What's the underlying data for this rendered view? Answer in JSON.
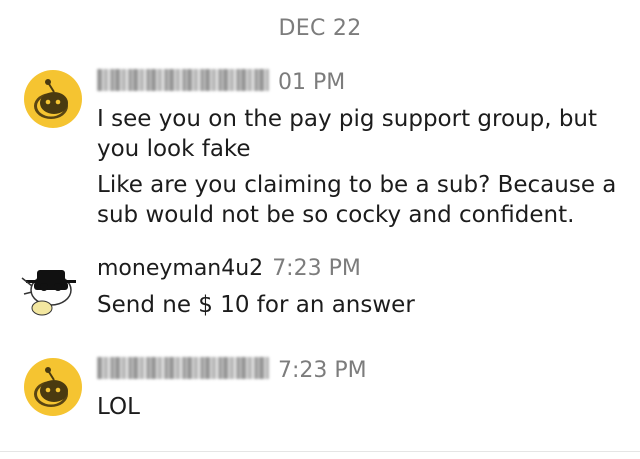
{
  "date_separator": "DEC 22",
  "messages": [
    {
      "username": "",
      "time": "7:01 PM",
      "time_visible": "01 PM",
      "lines": [
        "I see you on the pay pig support group, but you look fake",
        "Like are you claiming to be a sub? Because a sub would not be so cocky and confident."
      ]
    },
    {
      "username": "moneyman4u2",
      "time": "7:23 PM",
      "lines": [
        "Send ne $ 10 for an answer"
      ]
    },
    {
      "username": "",
      "time": "7:23 PM",
      "lines": [
        "LOL"
      ]
    }
  ],
  "colors": {
    "avatar_yellow": "#F5C431",
    "text": "#1C1C1C",
    "muted": "#7C7C7C"
  }
}
